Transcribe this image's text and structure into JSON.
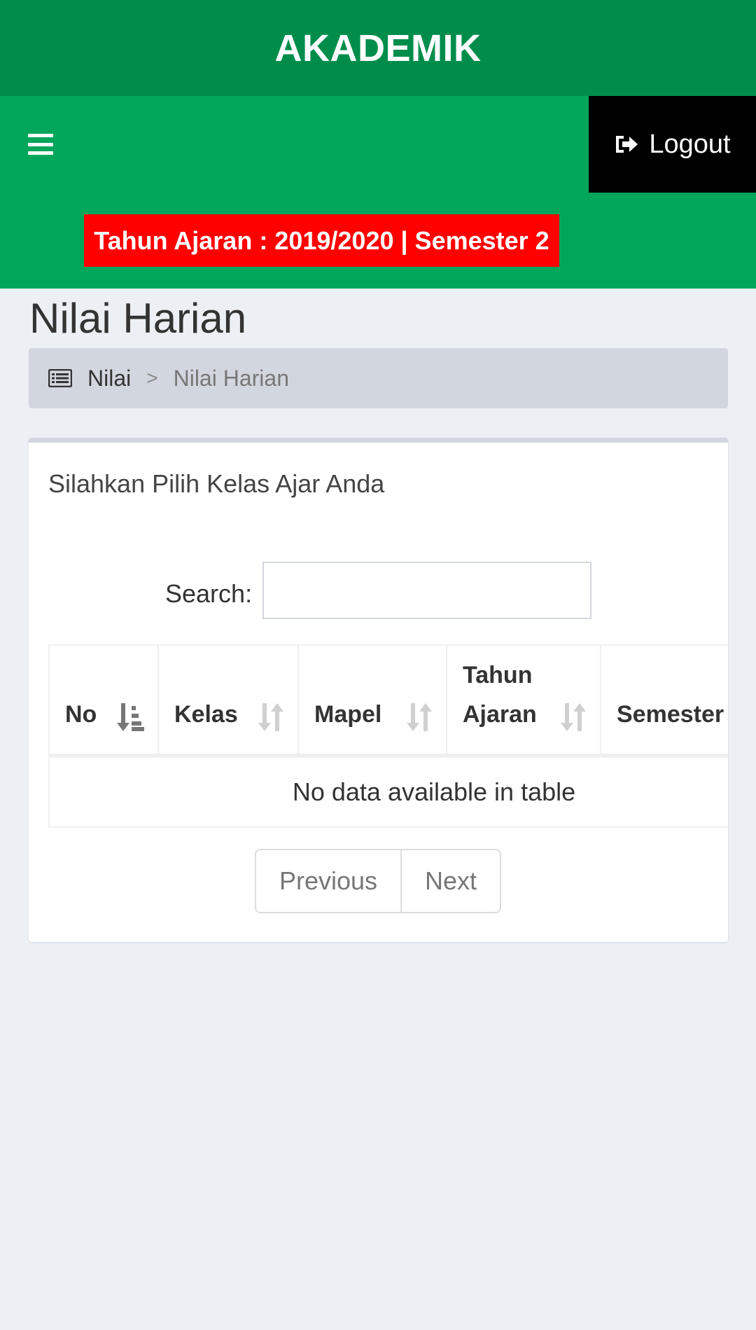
{
  "header": {
    "app_title": "AKADEMIK",
    "academic_period": "Tahun Ajaran : 2019/2020 | Semester 2",
    "logout_label": "Logout"
  },
  "page": {
    "title": "Nilai Harian"
  },
  "breadcrumb": {
    "items": [
      "Nilai",
      "Nilai Harian"
    ],
    "separator": ">"
  },
  "box": {
    "title": "Silahkan Pilih Kelas Ajar Anda",
    "search_label": "Search:",
    "search_value": "",
    "table": {
      "columns": [
        "No",
        "Kelas",
        "Mapel",
        "Tahun Ajaran",
        "Semester"
      ],
      "empty_message": "No data available in table"
    },
    "pagination": {
      "previous": "Previous",
      "next": "Next"
    }
  },
  "colors": {
    "logo_bar": "#008d4c",
    "navbar": "#00a65a",
    "period_badge": "#ff0000",
    "logout_bg": "#000000",
    "page_bg": "#ecf0f5"
  }
}
